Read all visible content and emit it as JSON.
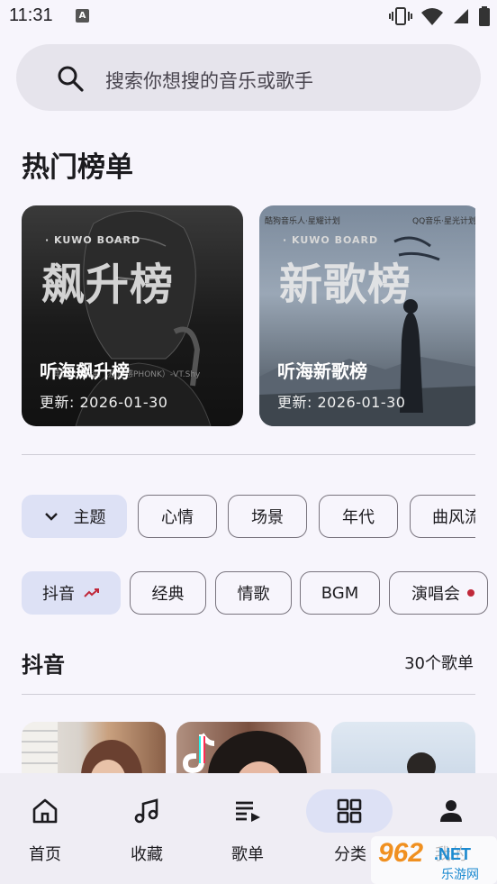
{
  "status_bar": {
    "time": "11:31",
    "notif_badge": "A"
  },
  "search": {
    "placeholder": "搜索你想搜的音乐或歌手"
  },
  "hot_charts": {
    "title": "热门榜单",
    "cards": [
      {
        "brand": "· KUWO BOARD",
        "big_text": "飙升榜",
        "name": "听海飙升榜",
        "updated": "更新: 2026-01-30",
        "caption": "典狱长进行曲（压迫感PHONK）-VT.Shy"
      },
      {
        "brand": "· KUWO BOARD",
        "big_text": "新歌榜",
        "name": "听海新歌榜",
        "updated": "更新: 2026-01-30",
        "top_left": "酷狗音乐人·星耀计划",
        "top_right": "QQ音乐·星光计划"
      }
    ]
  },
  "category_chips": [
    "主题",
    "心情",
    "场景",
    "年代",
    "曲风流"
  ],
  "tag_chips": [
    "抖音",
    "经典",
    "情歌",
    "BGM",
    "演唱会"
  ],
  "playlist_section": {
    "title": "抖音",
    "count": "30个歌单"
  },
  "bottom_nav": [
    {
      "label": "首页",
      "icon": "home-icon"
    },
    {
      "label": "收藏",
      "icon": "music-note-icon"
    },
    {
      "label": "歌单",
      "icon": "playlist-icon"
    },
    {
      "label": "分类",
      "icon": "grid-icon"
    },
    {
      "label": "我的",
      "icon": "person-icon"
    }
  ],
  "colors": {
    "accent_container": "#dde1f5",
    "background": "#f7f5fc",
    "trend_red": "#c0283a"
  },
  "watermark": {
    "brand": "962",
    "suffix": ".NET",
    "sub": "乐游网"
  }
}
